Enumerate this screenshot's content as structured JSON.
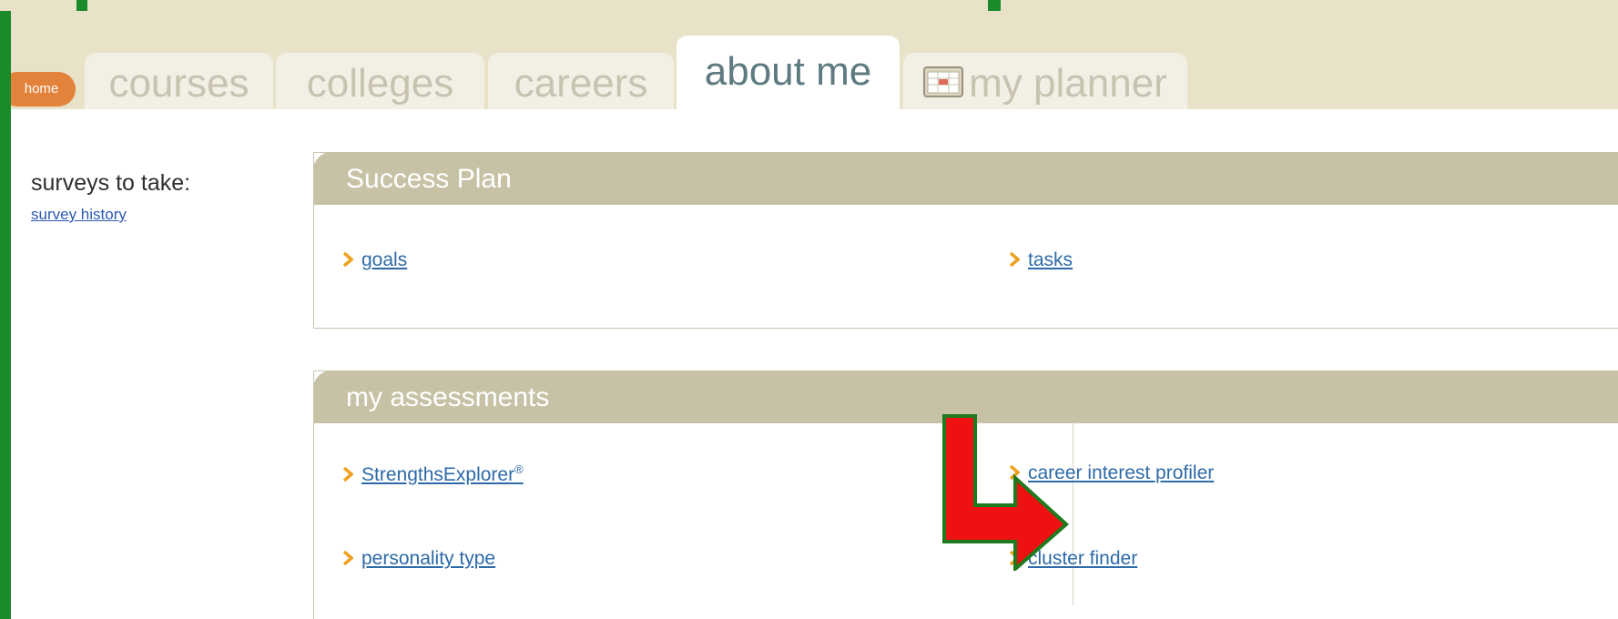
{
  "tabs": {
    "home": "home",
    "courses": "courses",
    "colleges": "colleges",
    "careers": "careers",
    "about_me": "about me",
    "my_planner": "my planner"
  },
  "sidebar": {
    "title": "surveys to take:",
    "link": "survey history"
  },
  "success_plan": {
    "title": "Success Plan",
    "items": [
      "goals",
      "tasks"
    ]
  },
  "assessments": {
    "title": "my assessments",
    "items": [
      "StrengthsExplorer",
      "career interest profiler",
      "personality type",
      "cluster finder"
    ],
    "registered_mark": "®"
  },
  "icons": {
    "bullet": "chevron-right-icon",
    "planner": "calendar-icon",
    "annotation": "red-arrow-icon"
  },
  "colors": {
    "background_frame": "#1a8a2a",
    "tab_bar": "#e8e2c8",
    "active_tab_text": "#5d7b80",
    "inactive_tab_text": "#c8c3b1",
    "home_button": "#e3823a",
    "section_header": "#c7c2a6",
    "link": "#2d6aa8",
    "bullet": "#f0a020",
    "arrow_fill": "#ee1111",
    "arrow_stroke": "#1e7a1e"
  }
}
